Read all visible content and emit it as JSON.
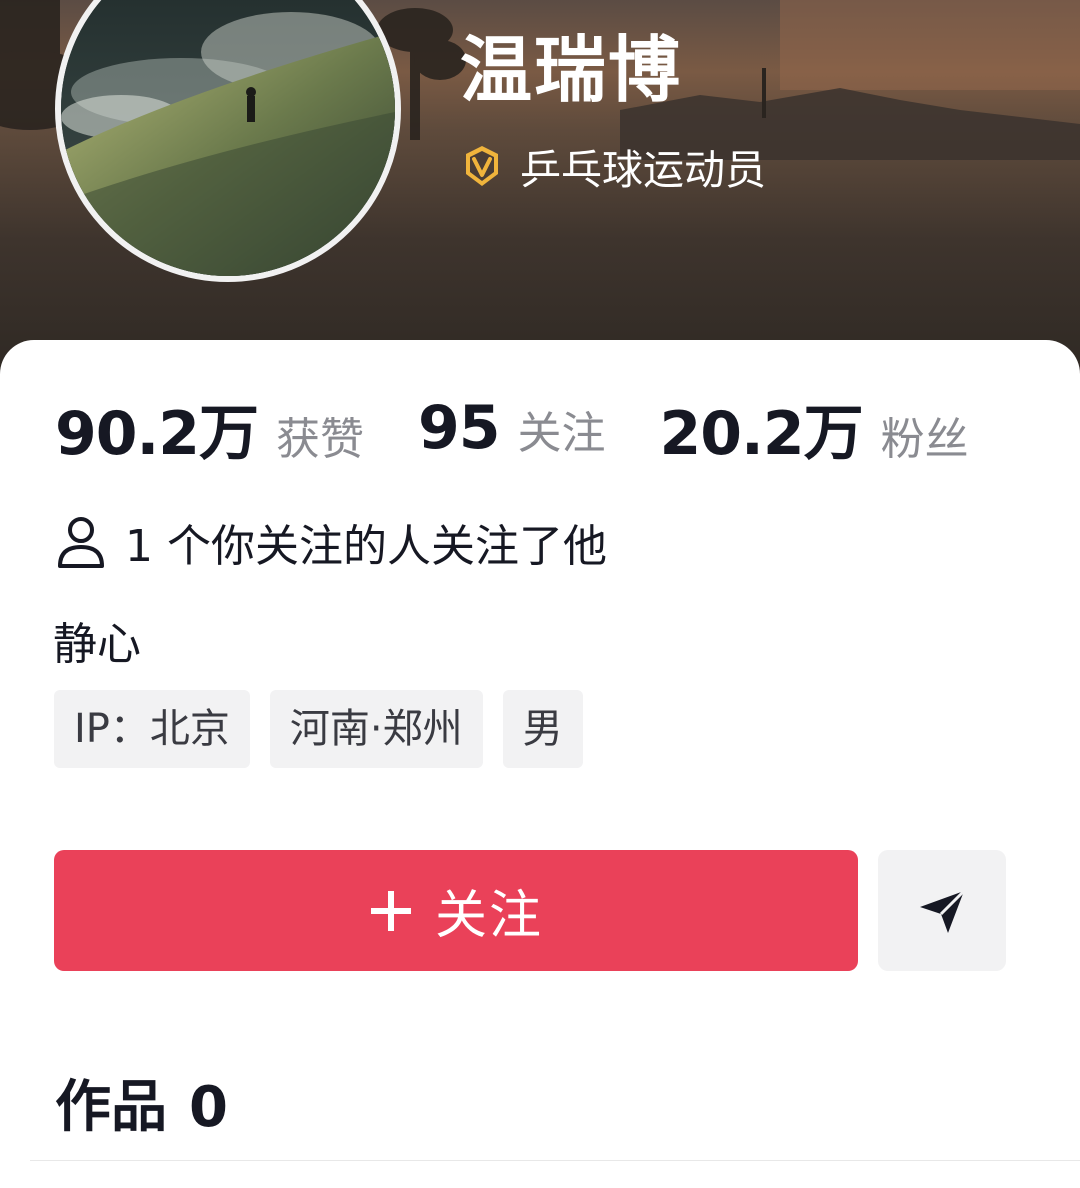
{
  "profile": {
    "name": "温瑞博",
    "verification": "乒乓球运动员",
    "verification_icon": "verified-v-badge-icon",
    "avatar_icon": "avatar-landscape-image"
  },
  "stats": [
    {
      "value": "90.2万",
      "label": "获赞"
    },
    {
      "value": "95",
      "label": "关注"
    },
    {
      "value": "20.2万",
      "label": "粉丝"
    }
  ],
  "mutual": {
    "icon": "person-icon",
    "text": "1 个你关注的人关注了他"
  },
  "bio": "静心",
  "tags": [
    "IP：北京",
    "河南·郑州",
    "男"
  ],
  "actions": {
    "follow_label": "关注",
    "follow_icon": "plus-icon",
    "share_icon": "send-icon"
  },
  "works": {
    "label": "作品",
    "count": "0"
  },
  "colors": {
    "accent": "#ea4159",
    "verify_gold": "#f0b43c",
    "text_primary": "#161823",
    "text_secondary": "#8a8b91",
    "tag_bg": "#f2f2f3"
  }
}
